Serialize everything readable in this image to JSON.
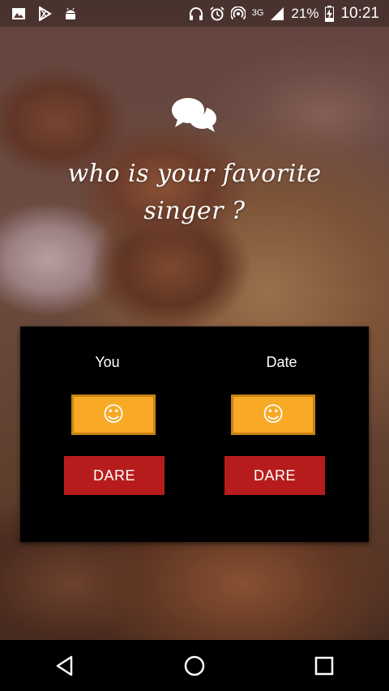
{
  "status_bar": {
    "network_type": "3G",
    "battery_percent": "21%",
    "time": "10:21",
    "icons": [
      "gallery-icon",
      "play-store-icon",
      "android-icon",
      "headphones-icon",
      "alarm-icon",
      "hotspot-icon",
      "signal-icon",
      "battery-charging-icon"
    ]
  },
  "header": {
    "icon": "chat-bubbles-icon",
    "question": "who is your favorite singer ?"
  },
  "panel": {
    "you": {
      "label": "You",
      "emoji": "☺",
      "dare_label": "DARE"
    },
    "date": {
      "label": "Date",
      "emoji": "☺",
      "dare_label": "DARE"
    }
  },
  "nav_bar": {
    "icons": [
      "back-icon",
      "home-icon",
      "recents-icon"
    ]
  },
  "colors": {
    "panel_bg": "#000000",
    "emoji_button": "#f8a926",
    "dare_button": "#b71c1c"
  }
}
